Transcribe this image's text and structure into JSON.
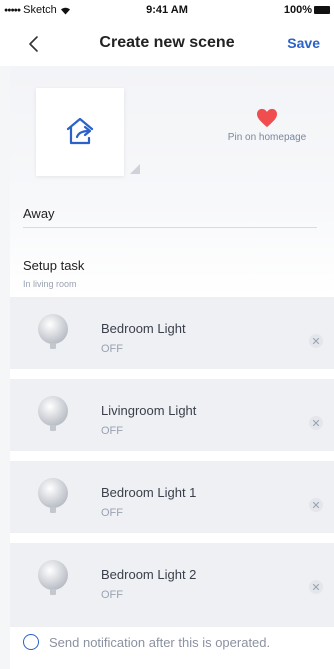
{
  "status_bar": {
    "carrier": "Sketch",
    "time": "9:41 AM",
    "battery": "100%"
  },
  "nav": {
    "title": "Create new scene",
    "save_label": "Save"
  },
  "scene": {
    "icon": "home-away-icon",
    "pin_label": "Pin on homepage",
    "name_value": "Away"
  },
  "setup": {
    "title": "Setup task",
    "subtitle": "In living room"
  },
  "tasks": [
    {
      "name": "Bedroom Light",
      "state": "OFF"
    },
    {
      "name": "Livingroom Light",
      "state": "OFF"
    },
    {
      "name": "Bedroom Light 1",
      "state": "OFF"
    },
    {
      "name": "Bedroom Light 2",
      "state": "OFF"
    }
  ],
  "notify": {
    "label": "Send notification after this is operated."
  },
  "colors": {
    "accent": "#2a62c9",
    "heart": "#f04e4e",
    "card_bg": "#eef0f4"
  }
}
